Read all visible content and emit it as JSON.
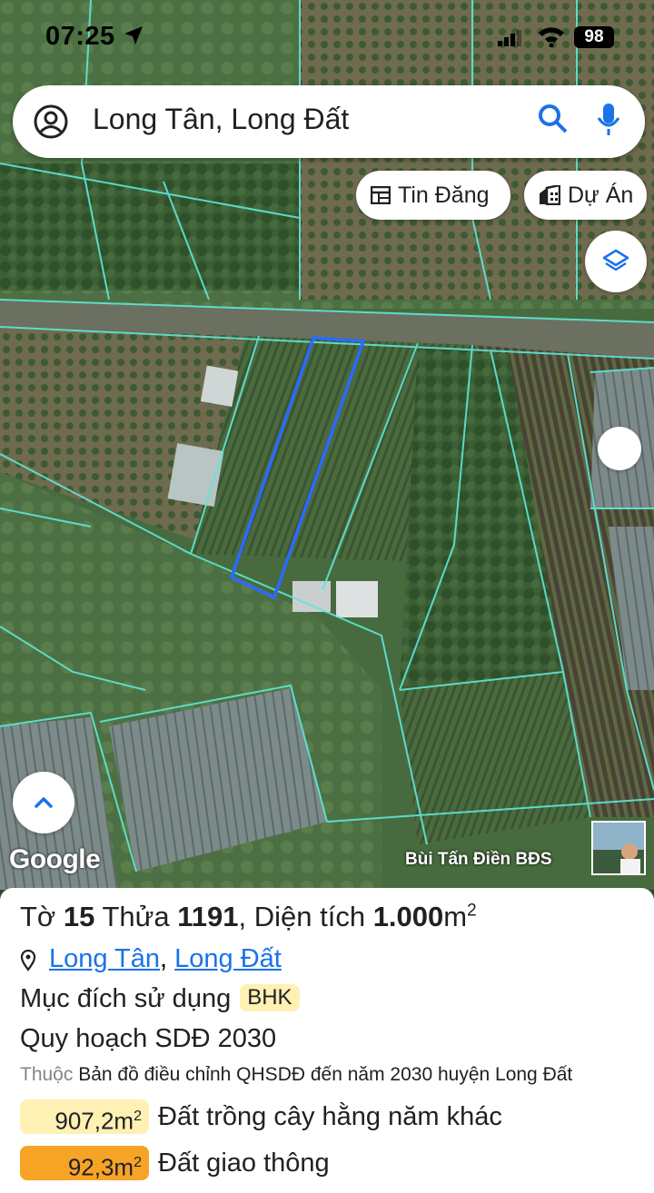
{
  "status_bar": {
    "time": "07:25",
    "battery": "98"
  },
  "search": {
    "query": "Long Tân, Long Đất"
  },
  "chips": {
    "tin_dang": "Tin Đăng",
    "du_an": "Dự Án"
  },
  "map": {
    "attribution": "Google",
    "author": "Bùi Tấn Điền BĐS"
  },
  "parcel": {
    "sheet_label": "Tờ",
    "sheet_no": "15",
    "plot_label": "Thửa",
    "plot_no": "1191",
    "area_label": ", Diện tích",
    "area_value": "1.000",
    "area_unit": "m",
    "location_commune": "Long Tân",
    "location_district": "Long Đất",
    "purpose_label": "Mục đích sử dụng",
    "purpose_code": "BHK",
    "planning_title": "Quy hoạch SDĐ 2030",
    "source_prefix": "Thuộc",
    "source_text": "Bản đồ điều chỉnh QHSDĐ đến năm 2030 huyện Long Đất",
    "zones": [
      {
        "area": "907,2m",
        "label": "Đất trồng cây hằng năm khác",
        "color": "#fff0b3"
      },
      {
        "area": "92,3m",
        "label": "Đất giao thông",
        "color": "#f7a326"
      }
    ]
  },
  "colors": {
    "accent": "#1a73e8",
    "parcel_outline": "#2a6bff",
    "boundary": "#5ee8d8"
  }
}
